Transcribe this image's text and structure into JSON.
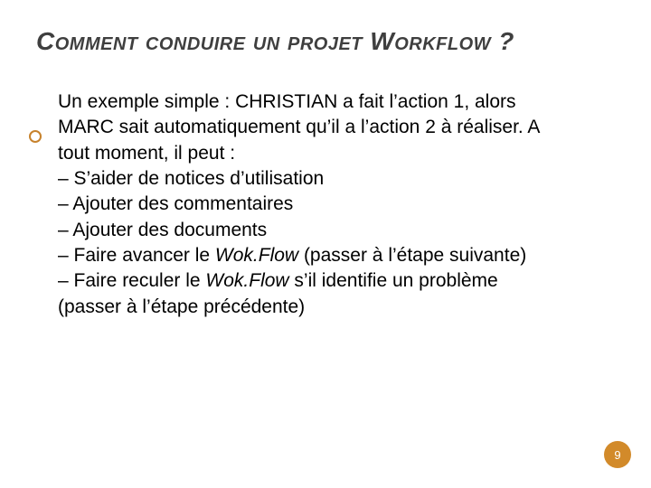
{
  "title": "Comment conduire un projet Workflow ?",
  "intro": "Un exemple simple : CHRISTIAN  a fait l’action 1, alors MARC sait automatiquement qu’il a l’action 2 à réaliser. A tout moment, il peut :",
  "dash1": "– S’aider de notices d’utilisation",
  "dash2": "– Ajouter des commentaires",
  "dash3": "– Ajouter des documents",
  "dash4_pre": "– Faire avancer le ",
  "dash4_it": "Wok.Flow",
  "dash4_post": "  (passer à l’étape suivante)",
  "dash5_pre": "– Faire reculer le ",
  "dash5_it": "Wok.Flow",
  "dash5_post": " s’il identifie un problème (passer à l’étape précédente)",
  "page": "9"
}
